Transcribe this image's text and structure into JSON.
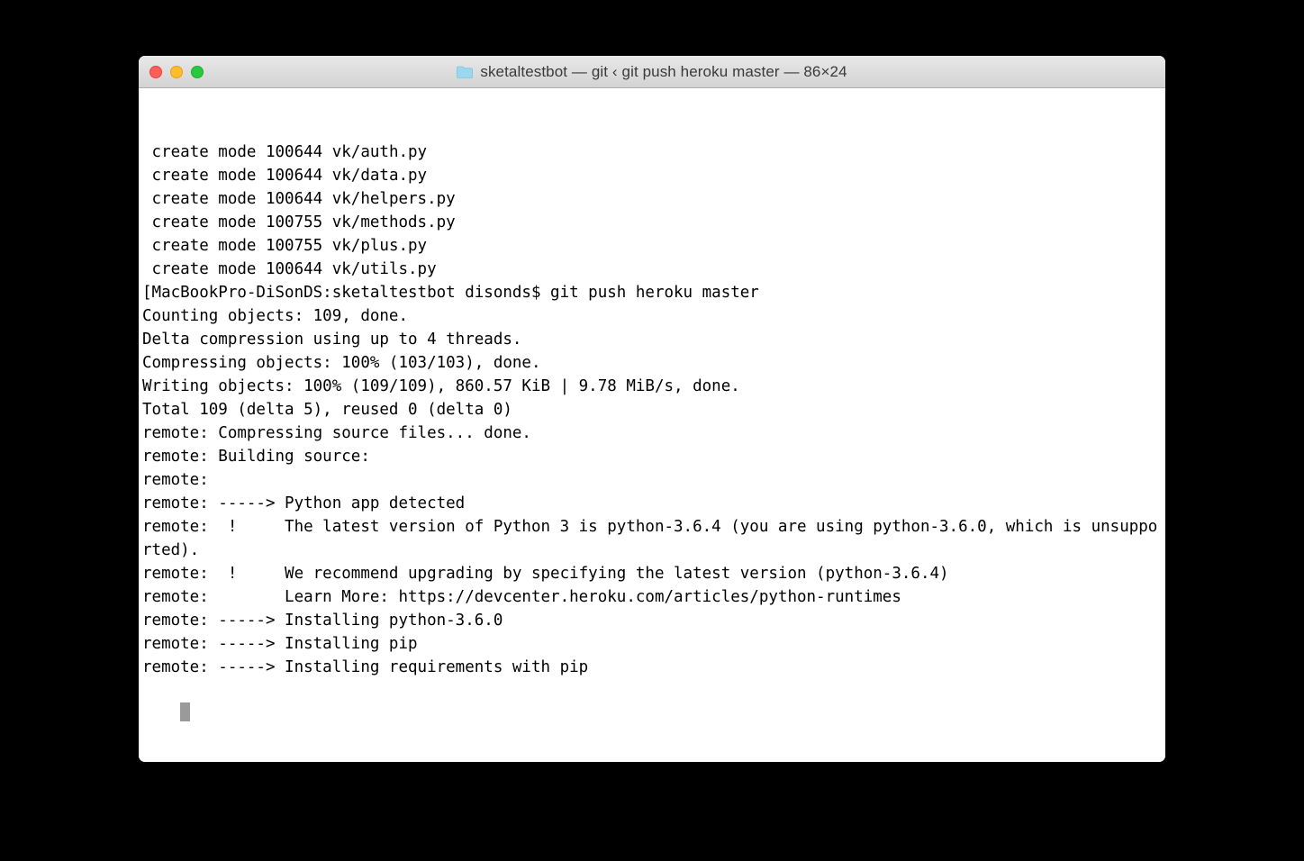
{
  "window": {
    "title": "sketaltestbot — git ‹ git push heroku master — 86×24",
    "folder_icon": "folder-icon"
  },
  "terminal": {
    "lines": [
      " create mode 100644 vk/auth.py",
      " create mode 100644 vk/data.py",
      " create mode 100644 vk/helpers.py",
      " create mode 100755 vk/methods.py",
      " create mode 100755 vk/plus.py",
      " create mode 100644 vk/utils.py",
      "[MacBookPro-DiSonDS:sketaltestbot disonds$ git push heroku master",
      "Counting objects: 109, done.",
      "Delta compression using up to 4 threads.",
      "Compressing objects: 100% (103/103), done.",
      "Writing objects: 100% (109/109), 860.57 KiB | 9.78 MiB/s, done.",
      "Total 109 (delta 5), reused 0 (delta 0)",
      "remote: Compressing source files... done.",
      "remote: Building source:",
      "remote:",
      "remote: -----> Python app detected",
      "remote:  !     The latest version of Python 3 is python-3.6.4 (you are using python-3.6.0, which is unsupported).",
      "remote:  !     We recommend upgrading by specifying the latest version (python-3.6.4)",
      "remote:        Learn More: https://devcenter.heroku.com/articles/python-runtimes",
      "remote: -----> Installing python-3.6.0",
      "remote: -----> Installing pip",
      "remote: -----> Installing requirements with pip"
    ]
  }
}
